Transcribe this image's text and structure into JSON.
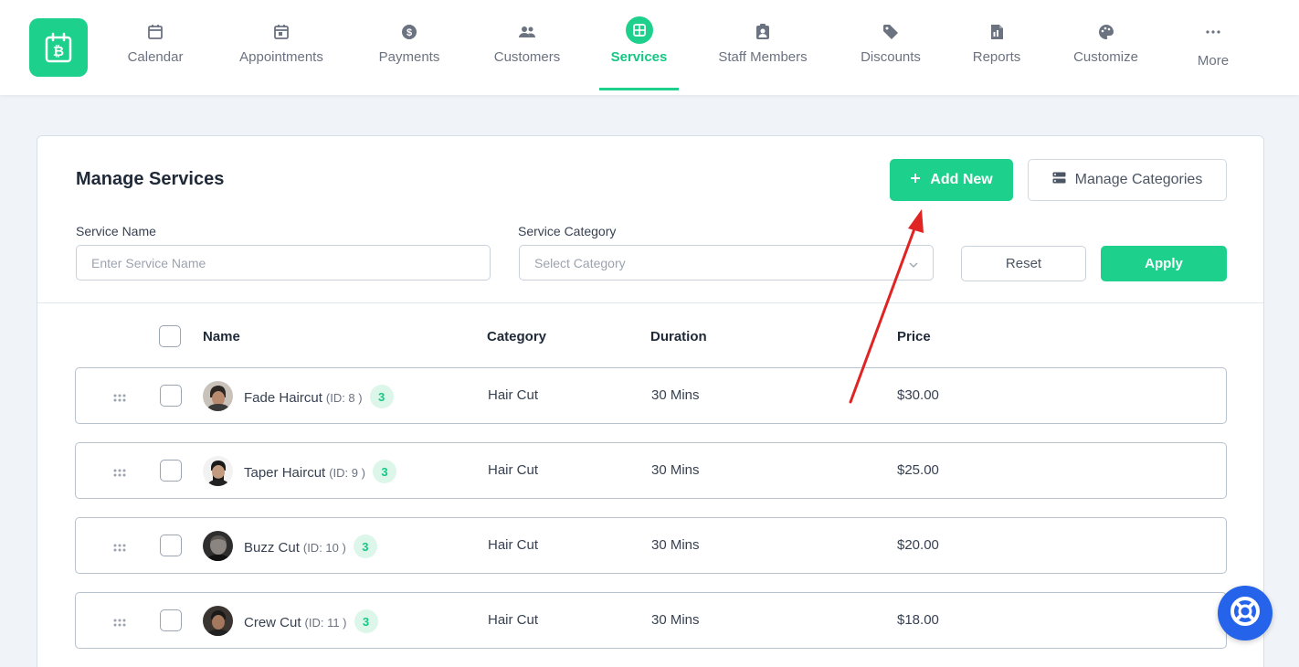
{
  "nav": {
    "items": [
      {
        "label": "Calendar",
        "icon": "calendar-icon"
      },
      {
        "label": "Appointments",
        "icon": "calendar-day-icon"
      },
      {
        "label": "Payments",
        "icon": "dollar-circle-icon"
      },
      {
        "label": "Customers",
        "icon": "users-icon"
      },
      {
        "label": "Services",
        "icon": "services-grid-icon",
        "active": true
      },
      {
        "label": "Staff Members",
        "icon": "id-badge-icon"
      },
      {
        "label": "Discounts",
        "icon": "tag-icon"
      },
      {
        "label": "Reports",
        "icon": "report-file-icon"
      },
      {
        "label": "Customize",
        "icon": "palette-icon"
      },
      {
        "label": "More",
        "icon": "ellipsis-icon"
      }
    ]
  },
  "page": {
    "title": "Manage Services",
    "add_new_label": "Add New",
    "manage_categories_label": "Manage Categories"
  },
  "filters": {
    "service_name_label": "Service Name",
    "service_name_placeholder": "Enter Service Name",
    "service_category_label": "Service Category",
    "service_category_placeholder": "Select Category",
    "reset_label": "Reset",
    "apply_label": "Apply"
  },
  "table": {
    "headers": {
      "name": "Name",
      "category": "Category",
      "duration": "Duration",
      "price": "Price"
    },
    "rows": [
      {
        "name": "Fade Haircut",
        "id_text": "(ID: 8 )",
        "badge": "3",
        "category": "Hair Cut",
        "duration": "30 Mins",
        "price": "$30.00"
      },
      {
        "name": "Taper Haircut",
        "id_text": "(ID: 9 )",
        "badge": "3",
        "category": "Hair Cut",
        "duration": "30 Mins",
        "price": "$25.00"
      },
      {
        "name": "Buzz Cut",
        "id_text": "(ID: 10 )",
        "badge": "3",
        "category": "Hair Cut",
        "duration": "30 Mins",
        "price": "$20.00"
      },
      {
        "name": "Crew Cut",
        "id_text": "(ID: 11 )",
        "badge": "3",
        "category": "Hair Cut",
        "duration": "30 Mins",
        "price": "$18.00"
      }
    ]
  },
  "colors": {
    "accent": "#1dd18c",
    "help": "#2563eb",
    "annotation_arrow": "#e02424"
  }
}
